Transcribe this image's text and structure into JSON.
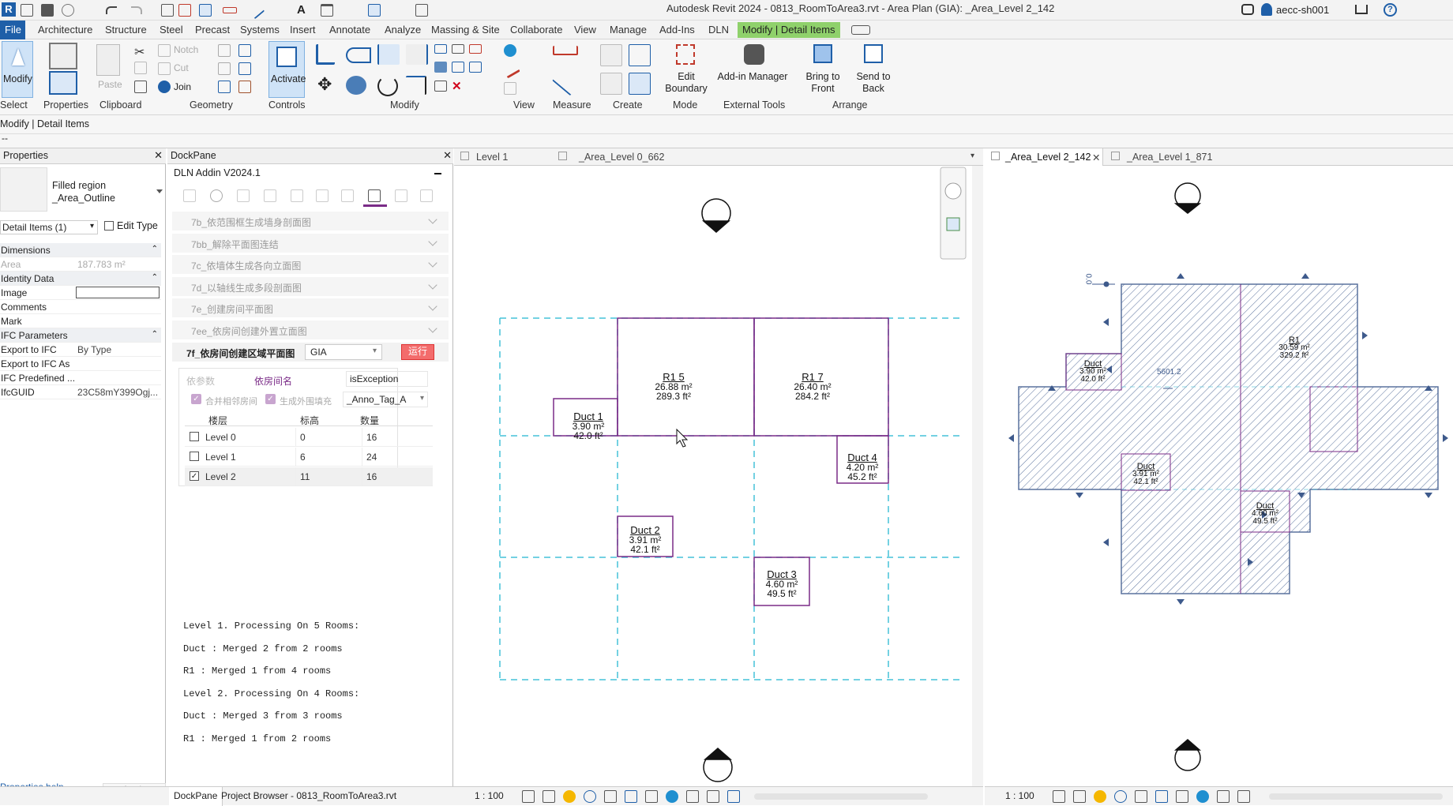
{
  "app": {
    "logo": "R",
    "title": "Autodesk Revit 2024 - 0813_RoomToArea3.rvt - Area Plan (GIA): _Area_Level 2_142",
    "user": "aecc-sh001"
  },
  "menu": {
    "file": "File",
    "tabs": [
      "Architecture",
      "Structure",
      "Steel",
      "Precast",
      "Systems",
      "Insert",
      "Annotate",
      "Analyze",
      "Massing & Site",
      "Collaborate",
      "View",
      "Manage",
      "Add-Ins",
      "DLN"
    ],
    "context_tab": "Modify | Detail Items"
  },
  "ribbon": {
    "modify": "Modify",
    "select": "Select",
    "properties": "Properties",
    "clipboard": "Clipboard",
    "paste": "Paste",
    "notch": "Notch",
    "cut": "Cut",
    "join": "Join",
    "geometry": "Geometry",
    "activate": "Activate",
    "controls": "Controls",
    "modify_group": "Modify",
    "view": "View",
    "measure": "Measure",
    "create": "Create",
    "edit_boundary_1": "Edit",
    "edit_boundary_2": "Boundary",
    "mode": "Mode",
    "addin_manager": "Add-in Manager",
    "external_tools": "External Tools",
    "bring_to_front_1": "Bring to",
    "bring_to_front_2": "Front",
    "send_to_back_1": "Send to",
    "send_to_back_2": "Back",
    "arrange": "Arrange"
  },
  "context_bar": "Modify | Detail Items",
  "option_bar": "--",
  "properties": {
    "title": "Properties",
    "type_line1": "Filled region",
    "type_line2": "_Area_Outline",
    "selector": "Detail Items (1)",
    "edit_type": "Edit Type",
    "rows": [
      {
        "k": "Dimensions",
        "v": "",
        "section": true
      },
      {
        "k": "Area",
        "v": "187.783 m²",
        "section": false
      },
      {
        "k": "Identity Data",
        "v": "",
        "section": true
      },
      {
        "k": "Image",
        "v": "",
        "section": false
      },
      {
        "k": "Comments",
        "v": "",
        "section": false
      },
      {
        "k": "Mark",
        "v": "",
        "section": false
      },
      {
        "k": "IFC Parameters",
        "v": "",
        "section": true
      },
      {
        "k": "Export to IFC",
        "v": "By Type",
        "section": false
      },
      {
        "k": "Export to IFC As",
        "v": "",
        "section": false
      },
      {
        "k": "IFC Predefined ...",
        "v": "",
        "section": false
      },
      {
        "k": "IfcGUID",
        "v": "23C58mY399Ogj...",
        "section": false
      }
    ],
    "help": "Properties help",
    "apply": "Apply"
  },
  "dock": {
    "title": "DockPane",
    "addin": "DLN Addin V2024.1",
    "commands": [
      "7b_依范围框生成墙身剖面图",
      "7bb_解除平面图连结",
      "7c_依墙体生成各向立面图",
      "7d_以轴线生成多段剖面图",
      "7e_创建房间平面图",
      "7ee_依房间创建外置立面图"
    ],
    "active_command": "7f_依房间创建区域平面图",
    "scheme": "GIA",
    "run": "运行",
    "field_label1": "依参数",
    "field_label2": "依房间名",
    "field_value": "isException",
    "chk1": "合并相邻房间",
    "chk2": "生成外围填充",
    "tag": "_Anno_Tag_A",
    "headers": [
      "楼层",
      "标高",
      "数量"
    ],
    "levels": [
      {
        "name": "Level 0",
        "elev": "0",
        "count": "16",
        "checked": false
      },
      {
        "name": "Level 1",
        "elev": "6",
        "count": "24",
        "checked": false
      },
      {
        "name": "Level 2",
        "elev": "11",
        "count": "16",
        "checked": true
      }
    ],
    "log": [
      "Level 1. Processing On 5 Rooms:",
      "Duct : Merged 2 from 2 rooms",
      "R1 : Merged 1 from 4 rooms",
      "Level 2. Processing On 4 Rooms:",
      "Duct : Merged 3 from 3 rooms",
      "R1 : Merged 1 from 2 rooms"
    ]
  },
  "views": {
    "left_tabs": [
      "Level 1",
      "_Area_Level 0_662"
    ],
    "right_tabs": [
      "_Area_Level 2_142",
      "_Area_Level 1_871"
    ],
    "left_rooms": [
      {
        "name": "R1 5",
        "a": "26.88 m²",
        "b": "289.3 ft²"
      },
      {
        "name": "R1 7",
        "a": "26.40 m²",
        "b": "284.2 ft²"
      },
      {
        "name": "Duct 1",
        "a": "3.90 m²",
        "b": "42.0 ft²"
      },
      {
        "name": "Duct 4",
        "a": "4.20 m²",
        "b": "45.2 ft²"
      },
      {
        "name": "Duct 2",
        "a": "3.91 m²",
        "b": "42.1 ft²"
      },
      {
        "name": "Duct 3",
        "a": "4.60 m²",
        "b": "49.5 ft²"
      }
    ],
    "right_rooms": [
      {
        "name": "R1",
        "a": "30.59 m²",
        "b": "329.2 ft²"
      },
      {
        "name": "Duct",
        "a": "3.90 m²",
        "b": "42.0 ft²"
      },
      {
        "name": "Duct",
        "a": "3.91 m²",
        "b": "42.1 ft²"
      },
      {
        "name": "Duct",
        "a": "4.60 m²",
        "b": "49.5 ft²"
      }
    ],
    "dimension": "5601.2",
    "elev_marker": "0.0",
    "scale": "1 : 100"
  },
  "bottom": {
    "dockpane_tab": "DockPane",
    "browser_tab": "Project Browser - 0813_RoomToArea3.rvt"
  },
  "colors": {
    "accent": "#1f5fa8",
    "context_tab": "#8fd16b",
    "room_line": "#7a2b87",
    "grid": "#45c2d8",
    "hatch": "#3e5a8c"
  }
}
